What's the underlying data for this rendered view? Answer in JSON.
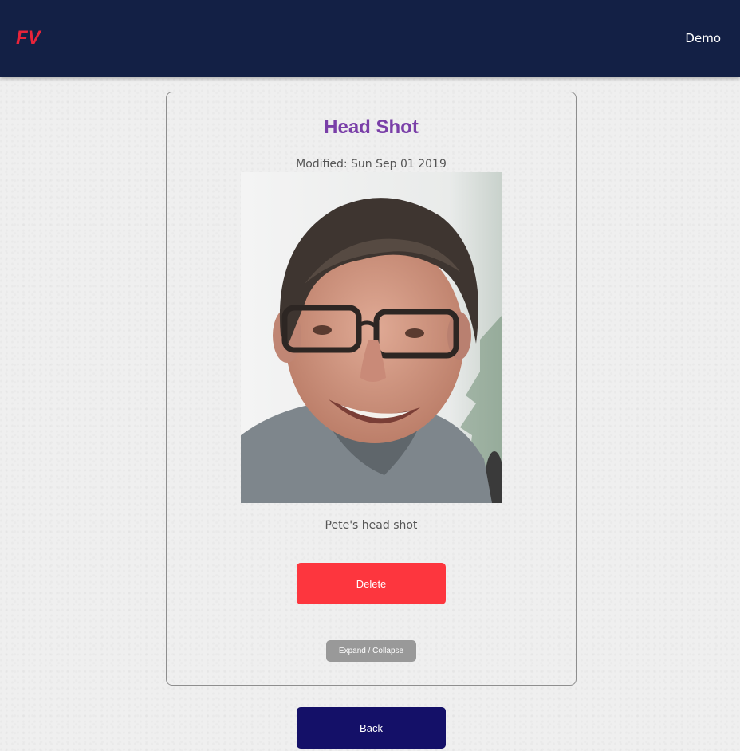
{
  "header": {
    "logo_text": "FV",
    "user_label": "Demo",
    "background_color": "#132045",
    "logo_color": "#e8243a"
  },
  "document": {
    "title": "Head Shot",
    "modified": "Modified: Sun Sep 01 2019",
    "caption": "Pete's head shot",
    "title_color": "#7a3fa8"
  },
  "actions": {
    "delete_label": "Delete",
    "toggle_label": "Expand / Collapse",
    "back_label": "Back",
    "delete_color": "#fd363e",
    "back_color": "#141068"
  }
}
